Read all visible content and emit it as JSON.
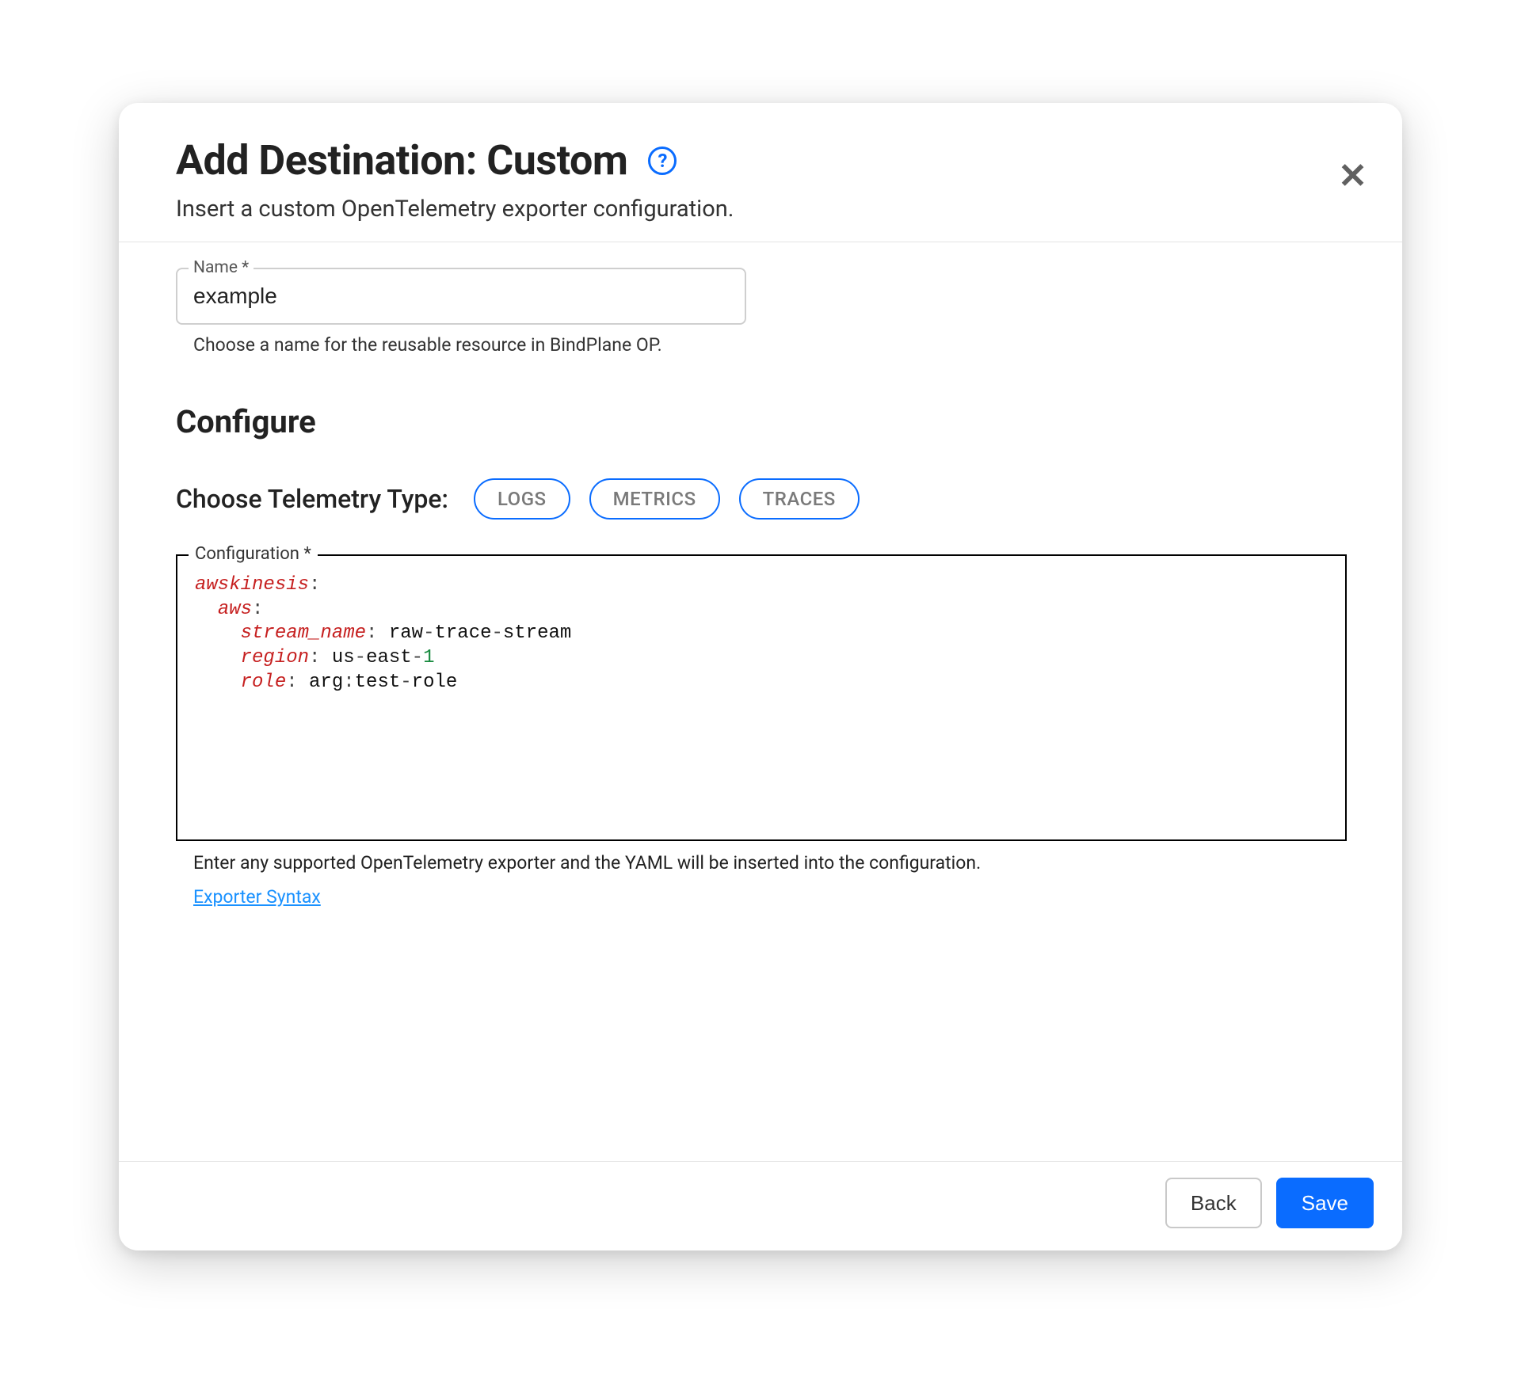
{
  "dialog": {
    "title": "Add Destination: Custom",
    "subtitle": "Insert a custom OpenTelemetry exporter configuration.",
    "help_icon_glyph": "?",
    "close_glyph": "✕"
  },
  "name_field": {
    "label": "Name *",
    "value": "example",
    "helper": "Choose a name for the reusable resource in BindPlane OP."
  },
  "configure": {
    "heading": "Configure",
    "telemetry_label": "Choose Telemetry Type:",
    "chips": [
      "LOGS",
      "METRICS",
      "TRACES"
    ]
  },
  "config_field": {
    "label": "Configuration *",
    "yaml_tokens": [
      {
        "type": "key",
        "text": "awskinesis"
      },
      {
        "type": "punc",
        "text": ":"
      },
      {
        "type": "nl"
      },
      {
        "type": "indent",
        "n": 1
      },
      {
        "type": "key",
        "text": "aws"
      },
      {
        "type": "punc",
        "text": ":"
      },
      {
        "type": "nl"
      },
      {
        "type": "indent",
        "n": 2
      },
      {
        "type": "key",
        "text": "stream_name"
      },
      {
        "type": "punc",
        "text": ": "
      },
      {
        "type": "plain",
        "text": "raw"
      },
      {
        "type": "punc",
        "text": "-"
      },
      {
        "type": "plain",
        "text": "trace"
      },
      {
        "type": "punc",
        "text": "-"
      },
      {
        "type": "plain",
        "text": "stream"
      },
      {
        "type": "nl"
      },
      {
        "type": "indent",
        "n": 2
      },
      {
        "type": "key",
        "text": "region"
      },
      {
        "type": "punc",
        "text": ": "
      },
      {
        "type": "plain",
        "text": "us"
      },
      {
        "type": "punc",
        "text": "-"
      },
      {
        "type": "plain",
        "text": "east"
      },
      {
        "type": "punc",
        "text": "-"
      },
      {
        "type": "num",
        "text": "1"
      },
      {
        "type": "nl"
      },
      {
        "type": "indent",
        "n": 2
      },
      {
        "type": "key",
        "text": "role"
      },
      {
        "type": "punc",
        "text": ": "
      },
      {
        "type": "plain",
        "text": "arg"
      },
      {
        "type": "punc",
        "text": ":"
      },
      {
        "type": "plain",
        "text": "test"
      },
      {
        "type": "punc",
        "text": "-"
      },
      {
        "type": "plain",
        "text": "role"
      }
    ],
    "helper": "Enter any supported OpenTelemetry exporter and the YAML will be inserted into the configuration.",
    "link_label": "Exporter Syntax"
  },
  "footer": {
    "back": "Back",
    "save": "Save"
  }
}
